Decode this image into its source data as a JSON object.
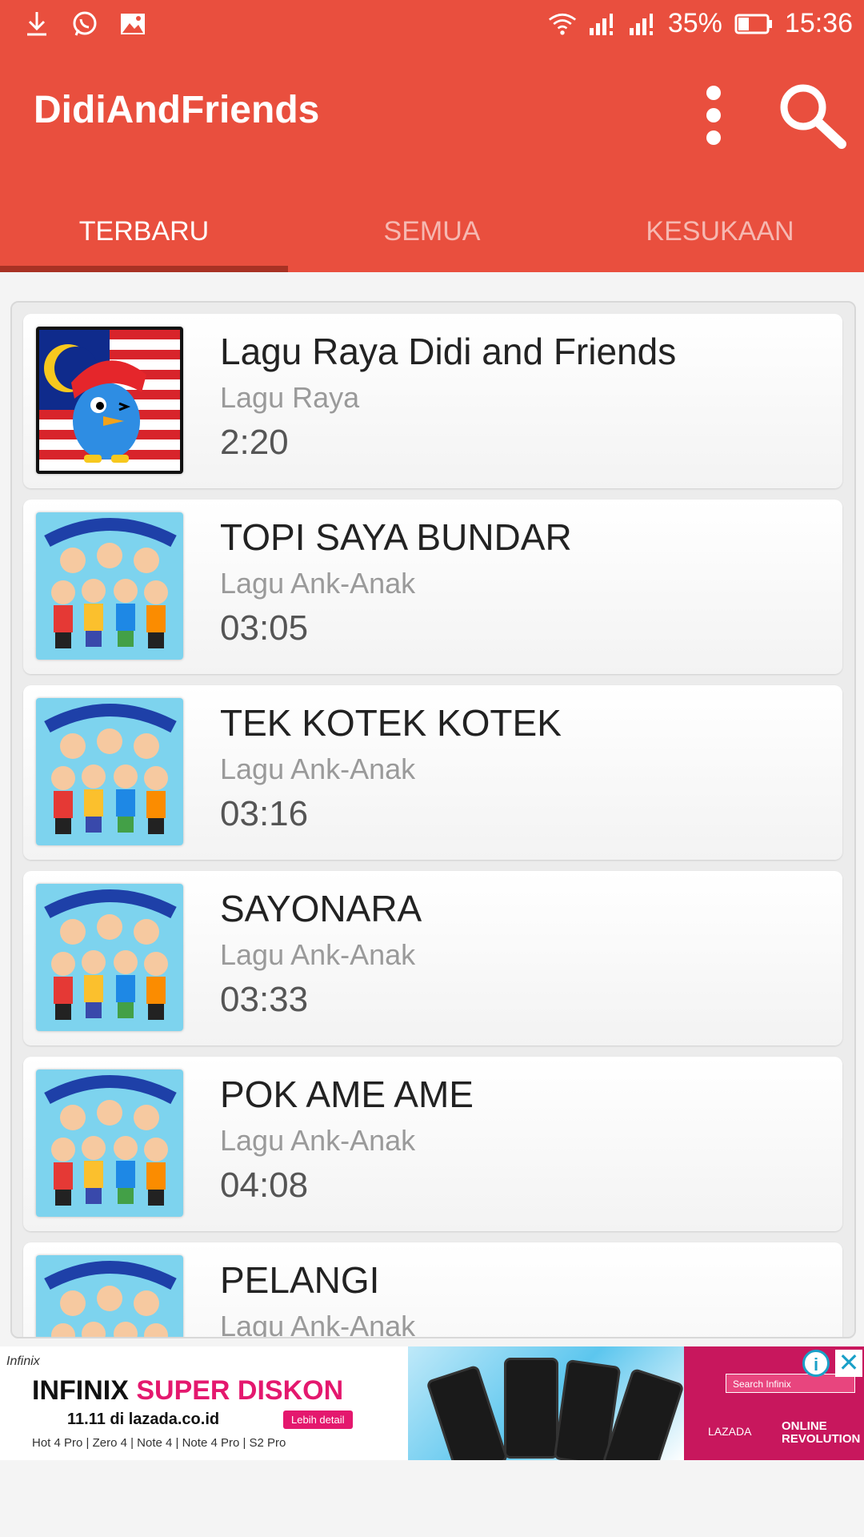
{
  "status_bar": {
    "battery": "35%",
    "time": "15:36",
    "left_icons": [
      "download-icon",
      "whatsapp-icon",
      "image-icon"
    ],
    "right_icons": [
      "wifi-icon",
      "signal-icon",
      "signal-icon",
      "battery-icon"
    ]
  },
  "app_bar": {
    "title": "DidiAndFriends",
    "menu_icon": "more-vert-icon",
    "search_icon": "search-icon",
    "color": "#e94f3e"
  },
  "tabs": [
    {
      "label": "TERBARU",
      "active": true
    },
    {
      "label": "SEMUA",
      "active": false
    },
    {
      "label": "KESUKAAN",
      "active": false
    }
  ],
  "songs": [
    {
      "title": "Lagu Raya Didi and Friends",
      "category": "Lagu Raya",
      "duration": "2:20"
    },
    {
      "title": "TOPI SAYA BUNDAR",
      "category": "Lagu Ank-Anak",
      "duration": "03:05"
    },
    {
      "title": "TEK KOTEK KOTEK",
      "category": "Lagu Ank-Anak",
      "duration": "03:16"
    },
    {
      "title": "SAYONARA",
      "category": "Lagu Ank-Anak",
      "duration": "03:33"
    },
    {
      "title": "POK AME AME",
      "category": "Lagu Ank-Anak",
      "duration": "04:08"
    },
    {
      "title": "PELANGI",
      "category": "Lagu Ank-Anak",
      "duration": ""
    }
  ],
  "ad": {
    "brand": "Infinix",
    "headline_a": "INFINIX ",
    "headline_b": "SUPER DISKON",
    "sub": "11.11 di lazada.co.id",
    "cta": "Lebih detail",
    "models": "Hot 4 Pro | Zero 4 | Note 4 | Note 4 Pro | S2 Pro",
    "search_placeholder": "Search Infinix",
    "lazada": "LAZADA",
    "revolution": "ONLINE REVOLUTION",
    "info": "i",
    "close": "✕"
  }
}
